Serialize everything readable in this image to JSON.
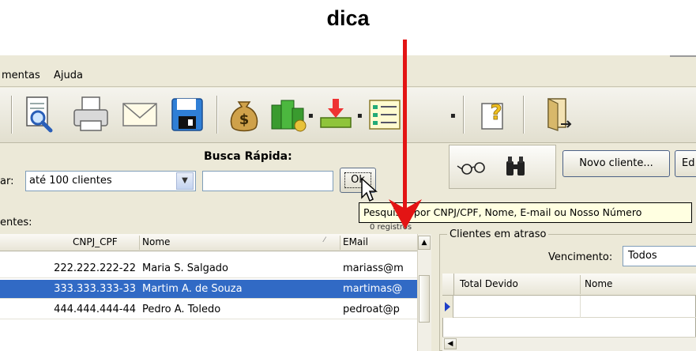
{
  "caption": "dica",
  "menu": {
    "items": [
      "mentas",
      "Ajuda"
    ]
  },
  "toolbar": {
    "icons": [
      "print-preview-icon",
      "printer-icon",
      "envelope-icon",
      "floppy-disk-icon",
      "money-bag-icon",
      "money-stack-icon",
      "download-tray-icon",
      "list-icon",
      "help-icon",
      "exit-door-icon"
    ],
    "dropdown_glyph": "▪"
  },
  "search": {
    "title": "Busca Rápida:",
    "filter_label": "ar:",
    "filter_value": "até 100 clientes",
    "query_value": "",
    "ok_label": "Ok"
  },
  "actions": {
    "new_client": "Novo cliente...",
    "edit_fragment": "Ed"
  },
  "clients": {
    "label": "entes:",
    "records_fragment": "0 registros",
    "columns": [
      "CNPJ_CPF",
      "Nome",
      "EMail"
    ],
    "rows": [
      {
        "cnpj": "222.222.222-22",
        "nome": "Maria S. Salgado",
        "email": "mariass@m",
        "selected": false
      },
      {
        "cnpj": "333.333.333-33",
        "nome": "Martim A. de Souza",
        "email": "martimas@",
        "selected": true
      },
      {
        "cnpj": "444.444.444-44",
        "nome": "Pedro A. Toledo",
        "email": "pedroat@p",
        "selected": false
      }
    ]
  },
  "overdue": {
    "title": "Clientes em atraso",
    "due_label": "Vencimento:",
    "due_value": "Todos",
    "columns": [
      "Total Devido",
      "Nome"
    ]
  },
  "tooltip": "Pesquisar por CNPJ/CPF, Nome, E-mail ou Nosso Número",
  "colors": {
    "selection": "#316ac5",
    "arrow": "#e31414",
    "tooltip_bg": "#ffffe1",
    "window_bg": "#ece9d8"
  }
}
